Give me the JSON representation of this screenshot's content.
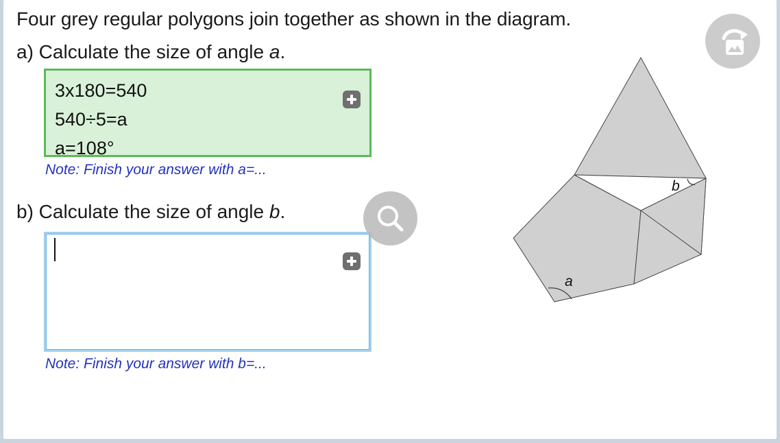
{
  "question": {
    "text": "Four grey regular polygons join together as shown in the diagram."
  },
  "part_a": {
    "prefix": "a) Calculate the size of angle ",
    "variable": "a",
    "suffix": ".",
    "answer_lines": [
      "3x180=540",
      "540÷5=a",
      "a=108°"
    ],
    "note": "Note: Finish your answer with a=..."
  },
  "part_b": {
    "prefix": "b) Calculate the size of angle ",
    "variable": "b",
    "suffix": ".",
    "answer_value": "",
    "note": "Note: Finish your answer with b=..."
  },
  "diagram": {
    "angle_label_a": "a",
    "angle_label_b": "b",
    "polygon_fill": "#d0d0d0"
  },
  "icons": {
    "add": "plus-icon",
    "zoom": "magnifier-icon",
    "image": "image-rotate-icon"
  },
  "colors": {
    "answer_a_background": "#d9f1d8",
    "answer_a_border": "#5cb85c",
    "answer_b_border": "#9fd0ee",
    "note_text": "#2233bb"
  }
}
